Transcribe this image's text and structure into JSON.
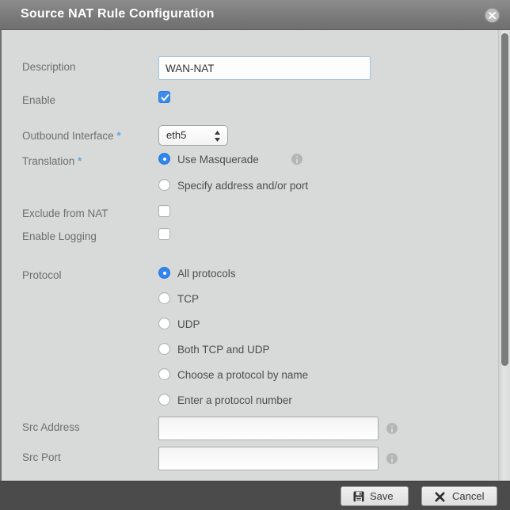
{
  "dialog": {
    "title": "Source NAT Rule Configuration",
    "close_icon": "close-icon"
  },
  "fields": {
    "description": {
      "label": "Description",
      "value": "WAN-NAT",
      "placeholder": ""
    },
    "enable": {
      "label": "Enable",
      "checked": true
    },
    "outbound_interface": {
      "label": "Outbound Interface",
      "required_marker": "*",
      "selected": "eth5"
    },
    "translation": {
      "label": "Translation",
      "required_marker": "*",
      "options": [
        {
          "label": "Use Masquerade",
          "selected": true,
          "info": true
        },
        {
          "label": "Specify address and/or port",
          "selected": false,
          "info": false
        }
      ]
    },
    "exclude_from_nat": {
      "label": "Exclude from NAT",
      "checked": false
    },
    "enable_logging": {
      "label": "Enable Logging",
      "checked": false
    },
    "protocol": {
      "label": "Protocol",
      "options": [
        {
          "label": "All protocols",
          "selected": true
        },
        {
          "label": "TCP",
          "selected": false
        },
        {
          "label": "UDP",
          "selected": false
        },
        {
          "label": "Both TCP and UDP",
          "selected": false
        },
        {
          "label": "Choose a protocol by name",
          "selected": false
        },
        {
          "label": "Enter a protocol number",
          "selected": false
        }
      ]
    },
    "src_address": {
      "label": "Src Address",
      "value": "",
      "placeholder": ""
    },
    "src_port": {
      "label": "Src Port",
      "value": "",
      "placeholder": ""
    }
  },
  "footer": {
    "save_label": "Save",
    "save_icon": "floppy-disk-icon",
    "cancel_label": "Cancel",
    "cancel_icon": "x-icon"
  },
  "colors": {
    "titlebar": "#7c7c7c",
    "body": "#d8dad9",
    "footer": "#4b4b4b",
    "accent_blue": "#3b8ced",
    "required_asterisk": "#62a8e0",
    "label_gray": "#6d6d6d"
  }
}
